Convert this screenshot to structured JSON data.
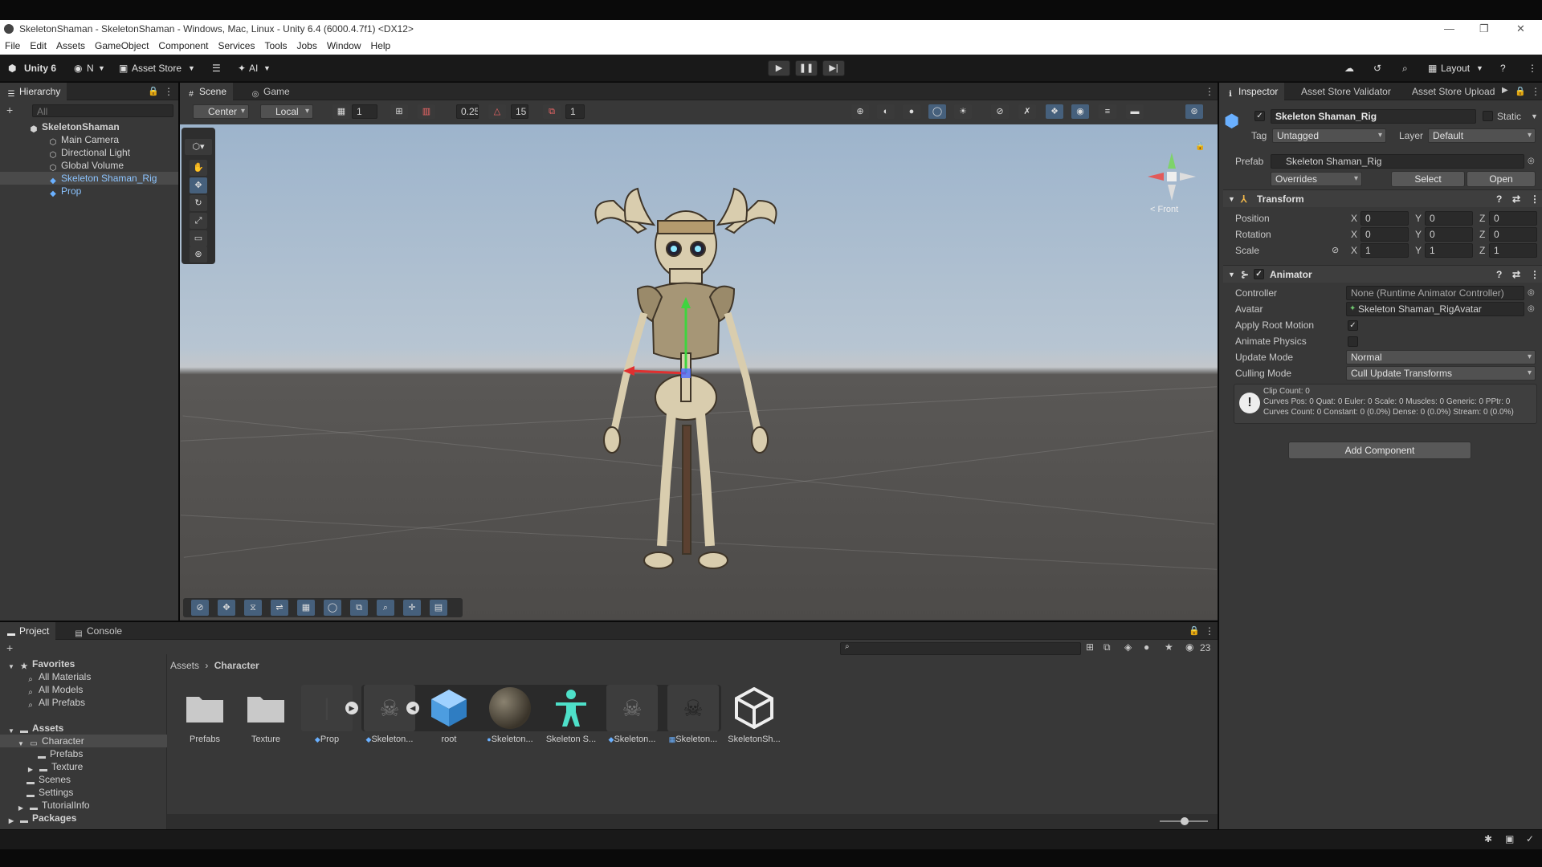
{
  "window": {
    "title": "SkeletonShaman - SkeletonShaman - Windows, Mac, Linux - Unity 6.4 (6000.4.7f1) <DX12>",
    "minimize": "—",
    "maximize": "❐",
    "close": "✕"
  },
  "menu": [
    "File",
    "Edit",
    "Assets",
    "GameObject",
    "Component",
    "Services",
    "Tools",
    "Jobs",
    "Window",
    "Help"
  ],
  "toolbar": {
    "unity_label": "Unity 6",
    "account": "N",
    "asset_store": "Asset Store",
    "ai": "AI",
    "layout": "Layout"
  },
  "hierarchy": {
    "tab": "Hierarchy",
    "search_placeholder": "All",
    "items": [
      {
        "label": "SkeletonShaman",
        "icon": "unity-scene-icon"
      },
      {
        "label": "Main Camera",
        "icon": "gameobject-icon"
      },
      {
        "label": "Directional Light",
        "icon": "gameobject-icon"
      },
      {
        "label": "Global Volume",
        "icon": "gameobject-icon"
      },
      {
        "label": "Skeleton Shaman_Rig",
        "icon": "prefab-icon"
      },
      {
        "label": "Prop",
        "icon": "prefab-icon"
      }
    ]
  },
  "scene": {
    "tabs": [
      "Scene",
      "Game"
    ],
    "toolbar": {
      "pivot": "Center",
      "space": "Local",
      "grid_value": "1",
      "snap_value": "0.25",
      "angle_value": "15",
      "scale_value": "1"
    },
    "gizmo_label": "< Front"
  },
  "inspector": {
    "tabs": [
      "Inspector",
      "Asset Store Validator",
      "Asset Store Upload"
    ],
    "object_name": "Skeleton Shaman_Rig",
    "static_label": "Static",
    "tag_label": "Tag",
    "tag_value": "Untagged",
    "layer_label": "Layer",
    "layer_value": "Default",
    "prefab_label": "Prefab",
    "prefab_value": "Skeleton Shaman_Rig",
    "overrides": "Overrides",
    "select": "Select",
    "open": "Open",
    "transform": {
      "title": "Transform",
      "rows": [
        {
          "label": "Position",
          "x": "0",
          "y": "0",
          "z": "0"
        },
        {
          "label": "Rotation",
          "x": "0",
          "y": "0",
          "z": "0"
        },
        {
          "label": "Scale",
          "x": "1",
          "y": "1",
          "z": "1"
        }
      ]
    },
    "animator": {
      "title": "Animator",
      "controller_label": "Controller",
      "controller_value": "None (Runtime Animator Controller)",
      "avatar_label": "Avatar",
      "avatar_value": "Skeleton Shaman_RigAvatar",
      "apply_root_label": "Apply Root Motion",
      "apply_root": true,
      "animate_physics_label": "Animate Physics",
      "animate_physics": false,
      "update_mode_label": "Update Mode",
      "update_mode": "Normal",
      "culling_mode_label": "Culling Mode",
      "culling_mode": "Cull Update Transforms",
      "info_line1": "Clip Count: 0",
      "info_line2": "Curves Pos: 0 Quat: 0 Euler: 0 Scale: 0 Muscles: 0 Generic: 0 PPtr: 0",
      "info_line3": "Curves Count: 0 Constant: 0 (0.0%) Dense: 0 (0.0%) Stream: 0 (0.0%)"
    },
    "add_component": "Add Component"
  },
  "project": {
    "tabs": [
      "Project",
      "Console"
    ],
    "count": "23",
    "favorites": {
      "label": "Favorites",
      "items": [
        "All Materials",
        "All Models",
        "All Prefabs"
      ]
    },
    "assets_tree": {
      "label": "Assets",
      "items": [
        {
          "label": "Character",
          "depth": 1
        },
        {
          "label": "Prefabs",
          "depth": 2
        },
        {
          "label": "Texture",
          "depth": 2
        },
        {
          "label": "Scenes",
          "depth": 1
        },
        {
          "label": "Settings",
          "depth": 1
        },
        {
          "label": "TutorialInfo",
          "depth": 1
        }
      ]
    },
    "packages": "Packages",
    "breadcrumb": [
      "Assets",
      "Character"
    ],
    "assets": [
      {
        "label": "Prefabs",
        "icon": "folder-icon"
      },
      {
        "label": "Texture",
        "icon": "folder-icon"
      },
      {
        "label": "Prop",
        "icon": "prefab-icon"
      },
      {
        "label": "Skeleton...",
        "icon": "model-icon"
      },
      {
        "label": "root",
        "icon": "mesh-icon"
      },
      {
        "label": "Skeleton...",
        "icon": "material-icon"
      },
      {
        "label": "Skeleton S...",
        "icon": "avatar-icon"
      },
      {
        "label": "Skeleton...",
        "icon": "prefab-icon"
      },
      {
        "label": "Skeleton...",
        "icon": "texture-icon"
      },
      {
        "label": "SkeletonSh...",
        "icon": "unity-scene-icon"
      }
    ]
  }
}
